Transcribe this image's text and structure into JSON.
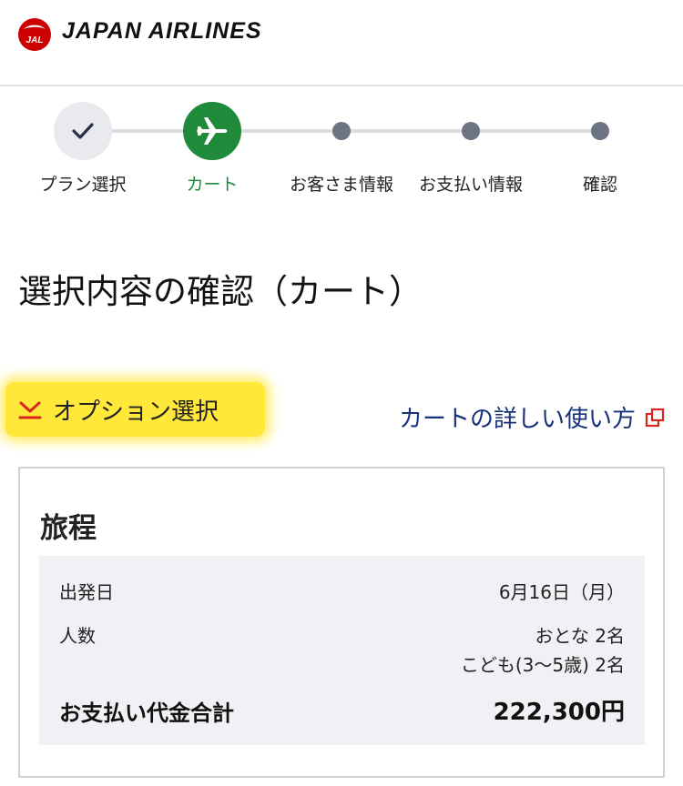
{
  "header": {
    "brand": "JAPAN AIRLINES",
    "logo_text": "JAL",
    "accent": "#cc0000"
  },
  "stepper": {
    "steps": [
      {
        "label": "プラン選択",
        "state": "done"
      },
      {
        "label": "カート",
        "state": "current"
      },
      {
        "label": "お客さま情報",
        "state": "upcoming"
      },
      {
        "label": "お支払い情報",
        "state": "upcoming"
      },
      {
        "label": "確認",
        "state": "upcoming"
      }
    ],
    "active_color": "#1f8a3a"
  },
  "page_title": "選択内容の確認（カート）",
  "options": {
    "toggle_label": "オプション選択",
    "howto_label": "カートの詳しい使い方",
    "link_color": "#16307a"
  },
  "itinerary": {
    "title": "旅程",
    "departure_label": "出発日",
    "departure_value": "6月16日（月）",
    "passengers_label": "人数",
    "adults": "おとな 2名",
    "children": "こども(3〜5歳) 2名",
    "total_label": "お支払い代金合計",
    "total_value": "222,300円"
  }
}
